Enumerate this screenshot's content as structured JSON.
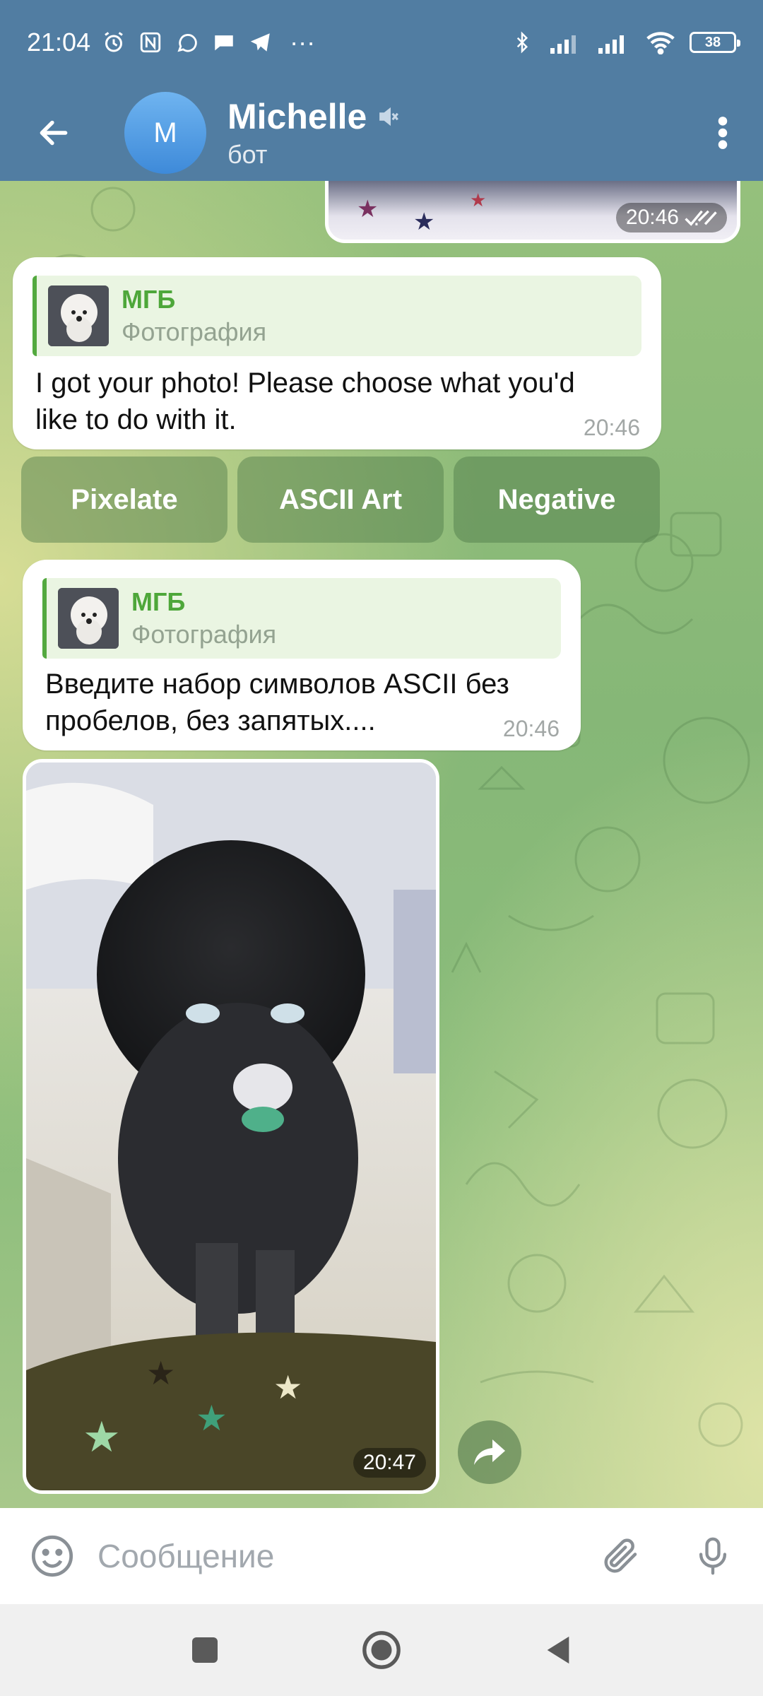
{
  "status": {
    "time": "21:04",
    "more": "···",
    "battery": "38",
    "icons_left": [
      "alarm-icon",
      "nfc-icon",
      "whatsapp-icon",
      "chat-icon",
      "telegram-icon"
    ],
    "icons_right": [
      "bluetooth-icon",
      "signal-icon",
      "signal-icon",
      "wifi-icon",
      "battery-icon"
    ]
  },
  "header": {
    "avatar_letter": "M",
    "title": "Michelle",
    "subtitle": "бот",
    "muted": true
  },
  "messages": {
    "top_photo_time": "20:46",
    "msg1": {
      "reply_author": "МГБ",
      "reply_type": "Фотография",
      "text_line1": "I got your photo! Please choose what you'd",
      "text_line2": "like to do with it.",
      "time": "20:46"
    },
    "keyboard": [
      "Pixelate",
      "ASCII Art",
      "Negative"
    ],
    "msg2": {
      "reply_author": "МГБ",
      "reply_type": "Фотография",
      "text_line1": "Введите набор символов ASCII без",
      "text_line2": "пробелов, без запятых....",
      "time": "20:46"
    },
    "photo_time": "20:47"
  },
  "composer": {
    "placeholder": "Сообщение"
  },
  "colors": {
    "header": "#517da2",
    "accent_green": "#4ea73a",
    "avatar": "#4a94df"
  }
}
